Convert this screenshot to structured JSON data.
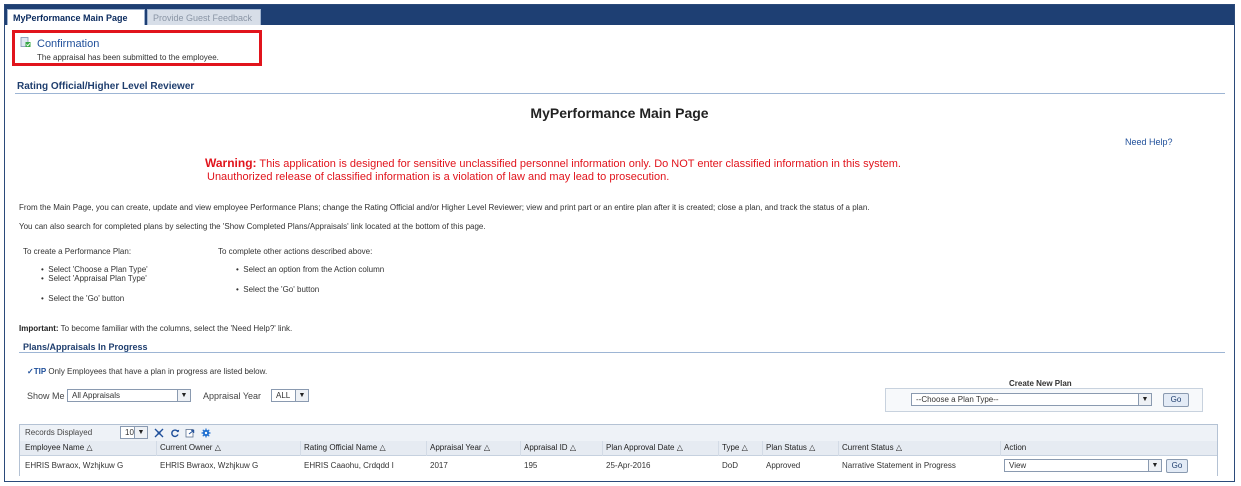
{
  "tabs": [
    {
      "label": "MyPerformance Main Page",
      "active": true
    },
    {
      "label": "Provide Guest Feedback",
      "active": false
    }
  ],
  "confirmation": {
    "title": "Confirmation",
    "message": "The appraisal has been submitted to the employee.",
    "highlight_color": "#e1141c"
  },
  "section_header": "Rating Official/Higher Level Reviewer",
  "page_title": "MyPerformance Main Page",
  "need_help": "Need Help?",
  "warning": {
    "label": "Warning:",
    "line1": " This application is designed for sensitive unclassified personnel information only. Do NOT enter classified information in this system.",
    "line2": "Unauthorized release of classified information is a violation of law and may lead to prosecution.",
    "color": "#e1141c"
  },
  "intro": {
    "p1": "From the Main Page, you can create, update and view employee Performance Plans; change the Rating Official and/or Higher Level Reviewer; view and print part or an entire plan after it is created; close a plan, and track the status of a plan.",
    "p2": "You can also search for completed plans by selecting the 'Show Completed Plans/Appraisals' link located at the bottom of this page."
  },
  "instructions": {
    "create_heading": "To create a Performance Plan:",
    "create_steps": [
      "Select 'Choose a Plan Type'",
      "Select 'Appraisal Plan Type'",
      "Select the 'Go' button"
    ],
    "other_heading": "To complete other actions described above:",
    "other_steps": [
      "Select an option from the Action column",
      "Select the 'Go' button"
    ]
  },
  "important": {
    "label": "Important:",
    "text": " To become familiar with the columns, select the 'Need Help?' link."
  },
  "plans": {
    "heading": "Plans/Appraisals In Progress",
    "tip_label": "TIP",
    "tip_text": " Only Employees that have a plan in progress are listed below.",
    "show_me_label": "Show Me",
    "show_me_value": "All Appraisals",
    "year_label": "Appraisal Year",
    "year_value": "ALL",
    "create_new_label": "Create New Plan",
    "plan_type_value": "--Choose a Plan Type--",
    "go_label": "Go"
  },
  "table": {
    "records_label": "Records Displayed",
    "records_value": "10",
    "toolbar_icons": [
      "detach-icon",
      "refresh-icon",
      "export-icon",
      "settings-icon"
    ],
    "columns": [
      "Employee Name",
      "Current Owner",
      "Rating Official Name",
      "Appraisal Year",
      "Appraisal ID",
      "Plan Approval Date",
      "Type",
      "Plan Status",
      "Current Status",
      "Action"
    ],
    "sort_glyph": "△",
    "rows": [
      {
        "employee_name": "EHRIS Bwraox, Wzhjkuw G",
        "current_owner": "EHRIS Bwraox, Wzhjkuw G",
        "rating_official": "EHRIS Caaohu, Crdqdd I",
        "appraisal_year": "2017",
        "appraisal_id": "195",
        "plan_approval_date": "25-Apr-2016",
        "type": "DoD",
        "plan_status": "Approved",
        "current_status": "Narrative Statement in Progress",
        "action_value": "View",
        "go_label": "Go"
      }
    ]
  }
}
